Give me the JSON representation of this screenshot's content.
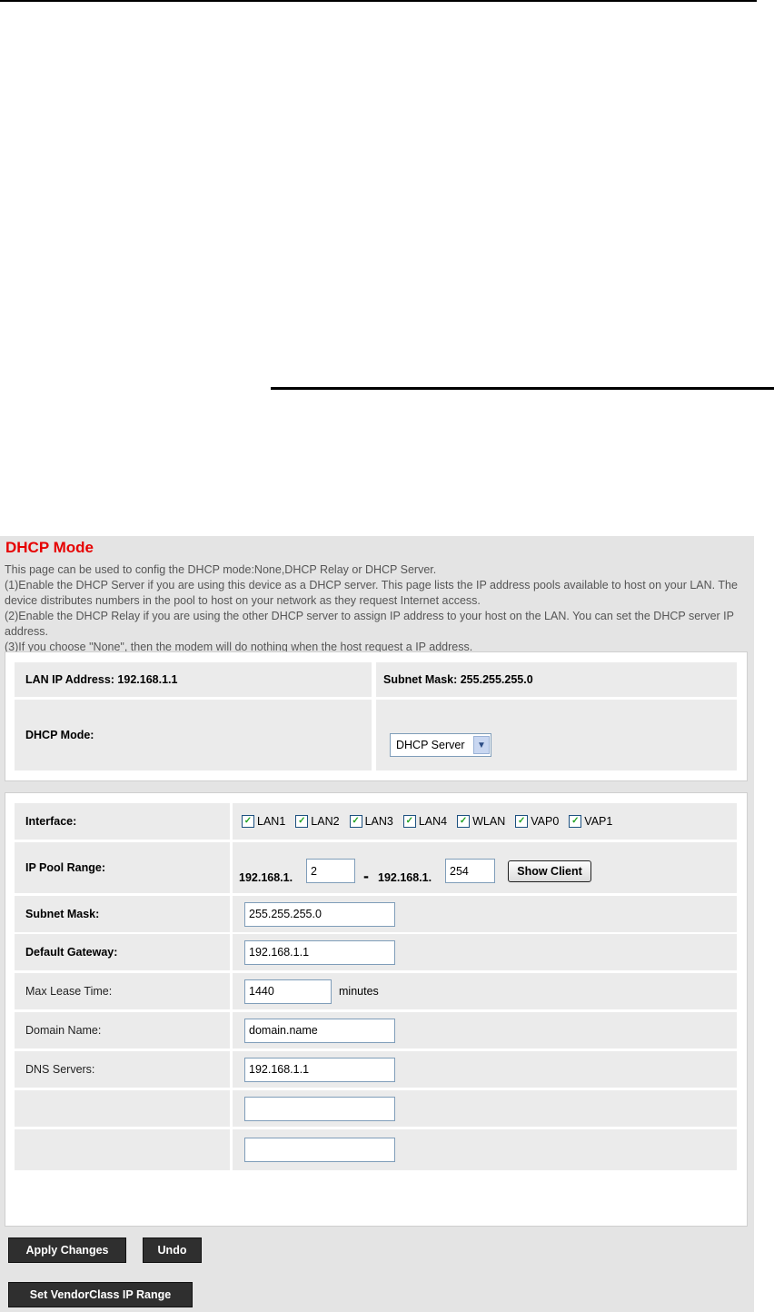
{
  "page": {
    "title": "DHCP Mode",
    "description": [
      "This page can be used to config the DHCP mode:None,DHCP Relay or DHCP Server.",
      "(1)Enable the DHCP Server if you are using this device as a DHCP server. This page lists the IP address pools available to host on your LAN. The device distributes numbers in the pool to host on your network as they request Internet access.",
      "(2)Enable the DHCP Relay if you are using the other DHCP server to assign IP address to your host on the LAN. You can set the DHCP server IP address.",
      "(3)If you choose \"None\", then the modem will do nothing when the host request a IP address."
    ]
  },
  "lan": {
    "ip_label": "LAN IP Address: 192.168.1.1",
    "mask_label": "Subnet Mask: 255.255.255.0",
    "mode_label": "DHCP Mode:",
    "mode_value": "DHCP Server"
  },
  "config": {
    "interface_label": "Interface:",
    "interfaces": [
      {
        "name": "LAN1",
        "checked": true
      },
      {
        "name": "LAN2",
        "checked": true
      },
      {
        "name": "LAN3",
        "checked": true
      },
      {
        "name": "LAN4",
        "checked": true
      },
      {
        "name": "WLAN",
        "checked": true
      },
      {
        "name": "VAP0",
        "checked": true
      },
      {
        "name": "VAP1",
        "checked": true
      }
    ],
    "pool_label": "IP Pool Range:",
    "pool_prefix": "192.168.1.",
    "pool_start": "2",
    "pool_dash": "-",
    "pool_end": "254",
    "show_client": "Show Client",
    "mask_label": "Subnet Mask:",
    "mask_value": "255.255.255.0",
    "gateway_label": "Default Gateway:",
    "gateway_value": "192.168.1.1",
    "lease_label": "Max Lease Time:",
    "lease_value": "1440",
    "lease_unit": "minutes",
    "domain_label": "Domain Name:",
    "domain_value": "domain.name",
    "dns_label": "DNS Servers:",
    "dns1": "192.168.1.1",
    "dns2": "",
    "dns3": ""
  },
  "buttons": {
    "apply": "Apply Changes",
    "undo": "Undo",
    "vendor": "Set VendorClass IP Range"
  },
  "colors": {
    "title": "#e60000",
    "panel_bg": "#e4e4e4",
    "cell_bg": "#ebebeb",
    "button_dark": "#2f2f2f",
    "checkbox_check": "#21a121"
  }
}
